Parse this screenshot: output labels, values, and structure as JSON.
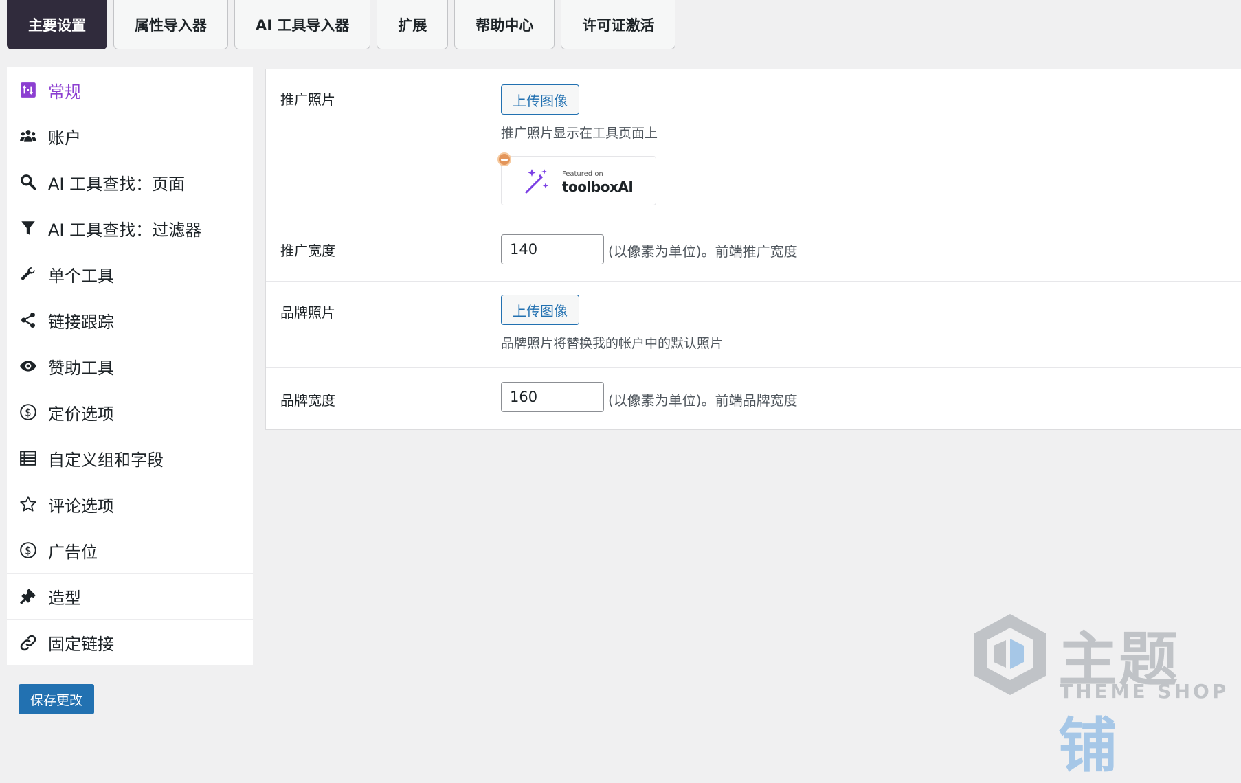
{
  "tabs": [
    {
      "label": "主要设置",
      "active": true
    },
    {
      "label": "属性导入器"
    },
    {
      "label": "AI 工具导入器"
    },
    {
      "label": "扩展"
    },
    {
      "label": "帮助中心"
    },
    {
      "label": "许可证激活"
    }
  ],
  "sidebar": {
    "items": [
      {
        "label": "常规",
        "icon": "general-settings-icon",
        "active": true
      },
      {
        "label": "账户",
        "icon": "users-icon"
      },
      {
        "label": "AI 工具查找：页面",
        "icon": "search-icon"
      },
      {
        "label": "AI 工具查找：过滤器",
        "icon": "filter-icon"
      },
      {
        "label": "单个工具",
        "icon": "wrench-icon"
      },
      {
        "label": "链接跟踪",
        "icon": "share-icon"
      },
      {
        "label": "赞助工具",
        "icon": "eye-icon"
      },
      {
        "label": "定价选项",
        "icon": "dollar-icon"
      },
      {
        "label": "自定义组和字段",
        "icon": "list-icon"
      },
      {
        "label": "评论选项",
        "icon": "star-icon"
      },
      {
        "label": "广告位",
        "icon": "dollar-icon"
      },
      {
        "label": "造型",
        "icon": "brush-icon"
      },
      {
        "label": "固定链接",
        "icon": "link-icon"
      }
    ]
  },
  "settings": {
    "promo_photo": {
      "label": "推广照片",
      "button": "上传图像",
      "description": "推广照片显示在工具页面上",
      "badge_featured": "Featured on",
      "badge_brand": "toolboxAI"
    },
    "promo_width": {
      "label": "推广宽度",
      "value": "140",
      "unit_text": "(以像素为单位)。前端推广宽度"
    },
    "brand_photo": {
      "label": "品牌照片",
      "button": "上传图像",
      "description": "品牌照片将替换我的帐户中的默认照片"
    },
    "brand_width": {
      "label": "品牌宽度",
      "value": "160",
      "unit_text": "(以像素为单位)。前端品牌宽度"
    }
  },
  "save_button": "保存更改",
  "watermark": {
    "cn_gray": "主题",
    "cn_blue": "铺",
    "en": "THEME SHOP"
  },
  "colors": {
    "active_tab": "#302b3c",
    "active_side": "#8c3fd1",
    "primary": "#2271b1"
  }
}
